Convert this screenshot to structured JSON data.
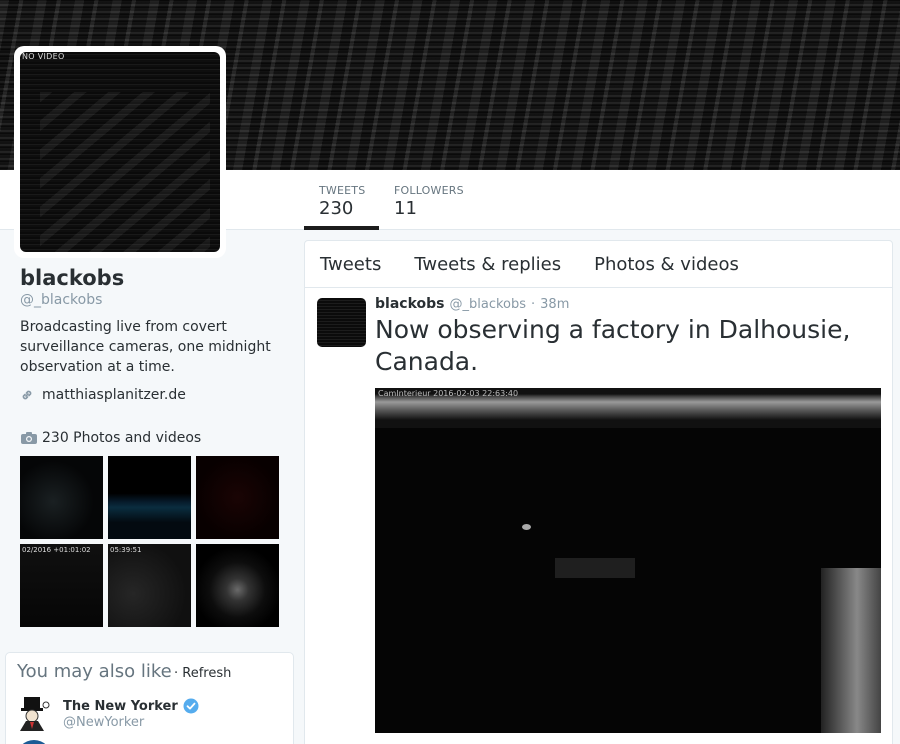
{
  "profile": {
    "avatar_overlay": "NO VIDEO",
    "name": "blackobs",
    "handle": "@_blackobs",
    "bio": "Broadcasting live from covert surveillance cameras, one midnight observation at a time.",
    "website": "matthiasplanitzer.de",
    "icons": {
      "link": "link-icon",
      "camera": "camera-icon"
    }
  },
  "stats": [
    {
      "label": "TWEETS",
      "value": "230"
    },
    {
      "label": "FOLLOWERS",
      "value": "11"
    }
  ],
  "photos": {
    "heading": "230 Photos and videos",
    "thumb_stamps": [
      "",
      "",
      "",
      "02/2016 +01:01:02",
      "05:39:51",
      ""
    ]
  },
  "suggestions": {
    "title": "You may also like",
    "refresh": "· Refresh",
    "items": [
      {
        "name": "The New Yorker",
        "handle": "@NewYorker",
        "verified": true
      }
    ]
  },
  "timeline": {
    "tabs": [
      "Tweets",
      "Tweets & replies",
      "Photos & videos"
    ],
    "tweet": {
      "name": "blackobs",
      "handle": "@_blackobs",
      "separator": "·",
      "time": "38m",
      "text": "Now observing a factory in Dalhousie, Canada.",
      "media_stamp": "CamInterieur 2016-02-03 22:63:40"
    }
  },
  "colors": {
    "accent": "#1c1c1c",
    "verified": "#55acee",
    "muted": "#8899a6"
  }
}
